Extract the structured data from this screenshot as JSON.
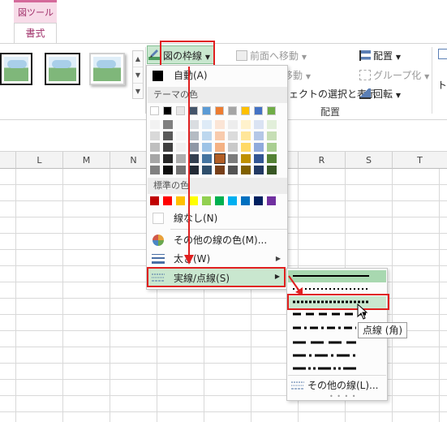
{
  "ribbon": {
    "contextual_tab_label": "図ツール",
    "active_tab": "書式",
    "bring_forward": "前面へ移動",
    "send_backward": "移動",
    "selection_pane": "ェクトの選択と表示",
    "align": "配置",
    "group": "グループ化",
    "rotate": "回転",
    "arrange_group_label": "配置",
    "crop_partial": "トリ"
  },
  "picture_border_button": {
    "label": "図の枠線"
  },
  "border_menu": {
    "automatic": "自動(A)",
    "theme_colors_header": "テーマの色",
    "standard_colors_header": "標準の色",
    "no_outline": "線なし(N)",
    "more_colors": "その他の線の色(M)...",
    "weight": "太さ(W)",
    "dashes": "実線/点線(S)",
    "theme_colors": [
      "#ffffff",
      "#000000",
      "#e7e6e6",
      "#44546a",
      "#5b9bd5",
      "#ed7d31",
      "#a5a5a5",
      "#ffc000",
      "#4472c4",
      "#70ad47"
    ],
    "standard_colors": [
      "#c00000",
      "#ff0000",
      "#ffc000",
      "#ffff00",
      "#92d050",
      "#00b050",
      "#00b0f0",
      "#0070c0",
      "#002060",
      "#7030a0"
    ]
  },
  "dash_submenu": {
    "more_lines": "その他の線(L)..."
  },
  "tooltip": "点線 (角)",
  "sheet": {
    "columns": [
      "L",
      "M",
      "N",
      "O",
      "P",
      "Q",
      "R",
      "S",
      "T"
    ]
  },
  "colors": {
    "accent_green": "#c9e7cf",
    "annotation_red": "#e02020",
    "picture_tools_pink": "#d4699a"
  }
}
